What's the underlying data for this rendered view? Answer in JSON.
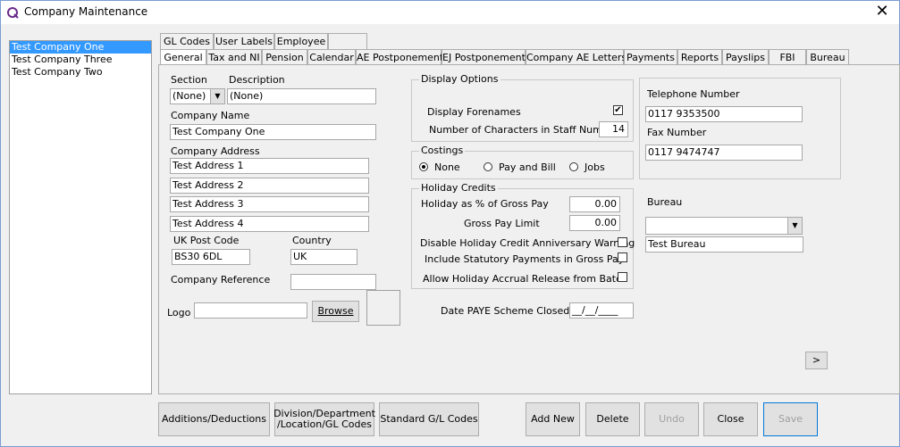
{
  "window": {
    "title": "Company Maintenance",
    "close_label": "✕"
  },
  "companies": [
    "Test Company One",
    "Test Company Three",
    "Test Company Two"
  ],
  "tabs_top": [
    "GL Codes",
    "User Labels",
    "Employee"
  ],
  "tabs": [
    "General",
    "Tax and NI",
    "Pension",
    "Calendar",
    "AE Postponement",
    "EJ Postponement",
    "Company AE Letters",
    "Payments",
    "Reports",
    "Payslips",
    "FBI",
    "Bureau"
  ],
  "general": {
    "section_label": "Section",
    "section_value": "(None)",
    "description_label": "Description",
    "description_value": "(None)",
    "company_name_label": "Company Name",
    "company_name_value": "Test Company One",
    "company_address_label": "Company Address",
    "address": [
      "Test Address 1",
      "Test Address 2",
      "Test Address 3",
      "Test Address 4"
    ],
    "postcode_label": "UK Post Code",
    "postcode_value": "BS30 6DL",
    "country_label": "Country",
    "country_value": "UK",
    "reference_label": "Company Reference",
    "reference_value": "",
    "logo_label": "Logo",
    "logo_value": "",
    "browse_label": "Browse"
  },
  "display_options": {
    "title": "Display Options",
    "display_forenames_label": "Display Forenames",
    "display_forenames_checked": true,
    "check_glyph": "✔",
    "staff_chars_label": "Number of Characters in Staff Number",
    "staff_chars_value": "14"
  },
  "costings": {
    "title": "Costings",
    "options": [
      "None",
      "Pay and Bill",
      "Jobs"
    ],
    "selected": "None"
  },
  "holiday": {
    "title": "Holiday Credits",
    "pct_label": "Holiday as % of Gross Pay",
    "pct_value": "0.00",
    "limit_label": "Gross Pay Limit",
    "limit_value": "0.00",
    "disable_anniv_label": "Disable Holiday Credit Anniversary Warning",
    "include_stat_label": "Include Statutory Payments in Gross Pay",
    "allow_accrual_label": "Allow Holiday Accrual Release from Batch"
  },
  "paye_closed": {
    "label": "Date PAYE Scheme Closed",
    "value": "__/__/____"
  },
  "contact": {
    "telephone_label": "Telephone Number",
    "telephone_value": "0117 9353500",
    "fax_label": "Fax Number",
    "fax_value": "0117 9474747"
  },
  "bureau": {
    "label": "Bureau",
    "dropdown_value": "",
    "name_value": "Test Bureau"
  },
  "next_label": ">",
  "buttons": {
    "additions": "Additions/Deductions",
    "division_line1": "Division/Department",
    "division_line2": "/Location/GL Codes",
    "standard_gl": "Standard G/L Codes",
    "add_new": "Add New",
    "delete": "Delete",
    "undo": "Undo",
    "close": "Close",
    "save": "Save"
  },
  "icons": {
    "app": "q-logo-icon",
    "dropdown": "chevron-down-icon",
    "close": "close-icon"
  }
}
